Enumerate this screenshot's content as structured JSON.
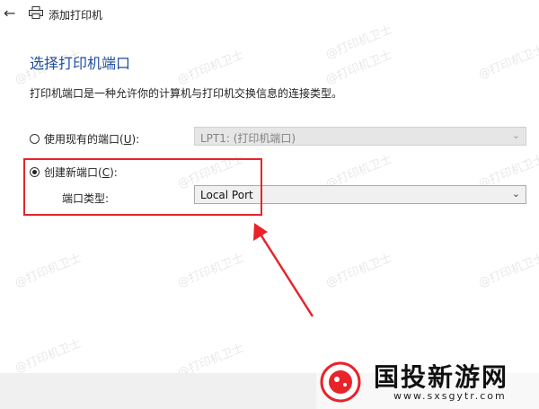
{
  "window": {
    "title": "添加打印机"
  },
  "page": {
    "heading": "选择打印机端口",
    "description": "打印机端口是一种允许你的计算机与打印机交换信息的连接类型。"
  },
  "existing_port": {
    "label_pre": "使用现有的端口(",
    "label_key": "U",
    "label_post": "):",
    "selected": false,
    "dropdown_value": "LPT1: (打印机端口)",
    "disabled": true
  },
  "new_port": {
    "label_pre": "创建新端口(",
    "label_key": "C",
    "label_post": "):",
    "selected": true,
    "type_label": "端口类型:",
    "dropdown_value": "Local Port"
  },
  "watermark": "@打印机卫士",
  "site_logo": {
    "text": "国投新游网",
    "url": "www.sxsgytr.com"
  },
  "colors": {
    "heading": "#1f4e9e",
    "highlight": "#e8232a",
    "footer": "#f0f0f0"
  },
  "icons": [
    "back-arrow-icon",
    "printer-icon",
    "chevron-down-icon"
  ]
}
